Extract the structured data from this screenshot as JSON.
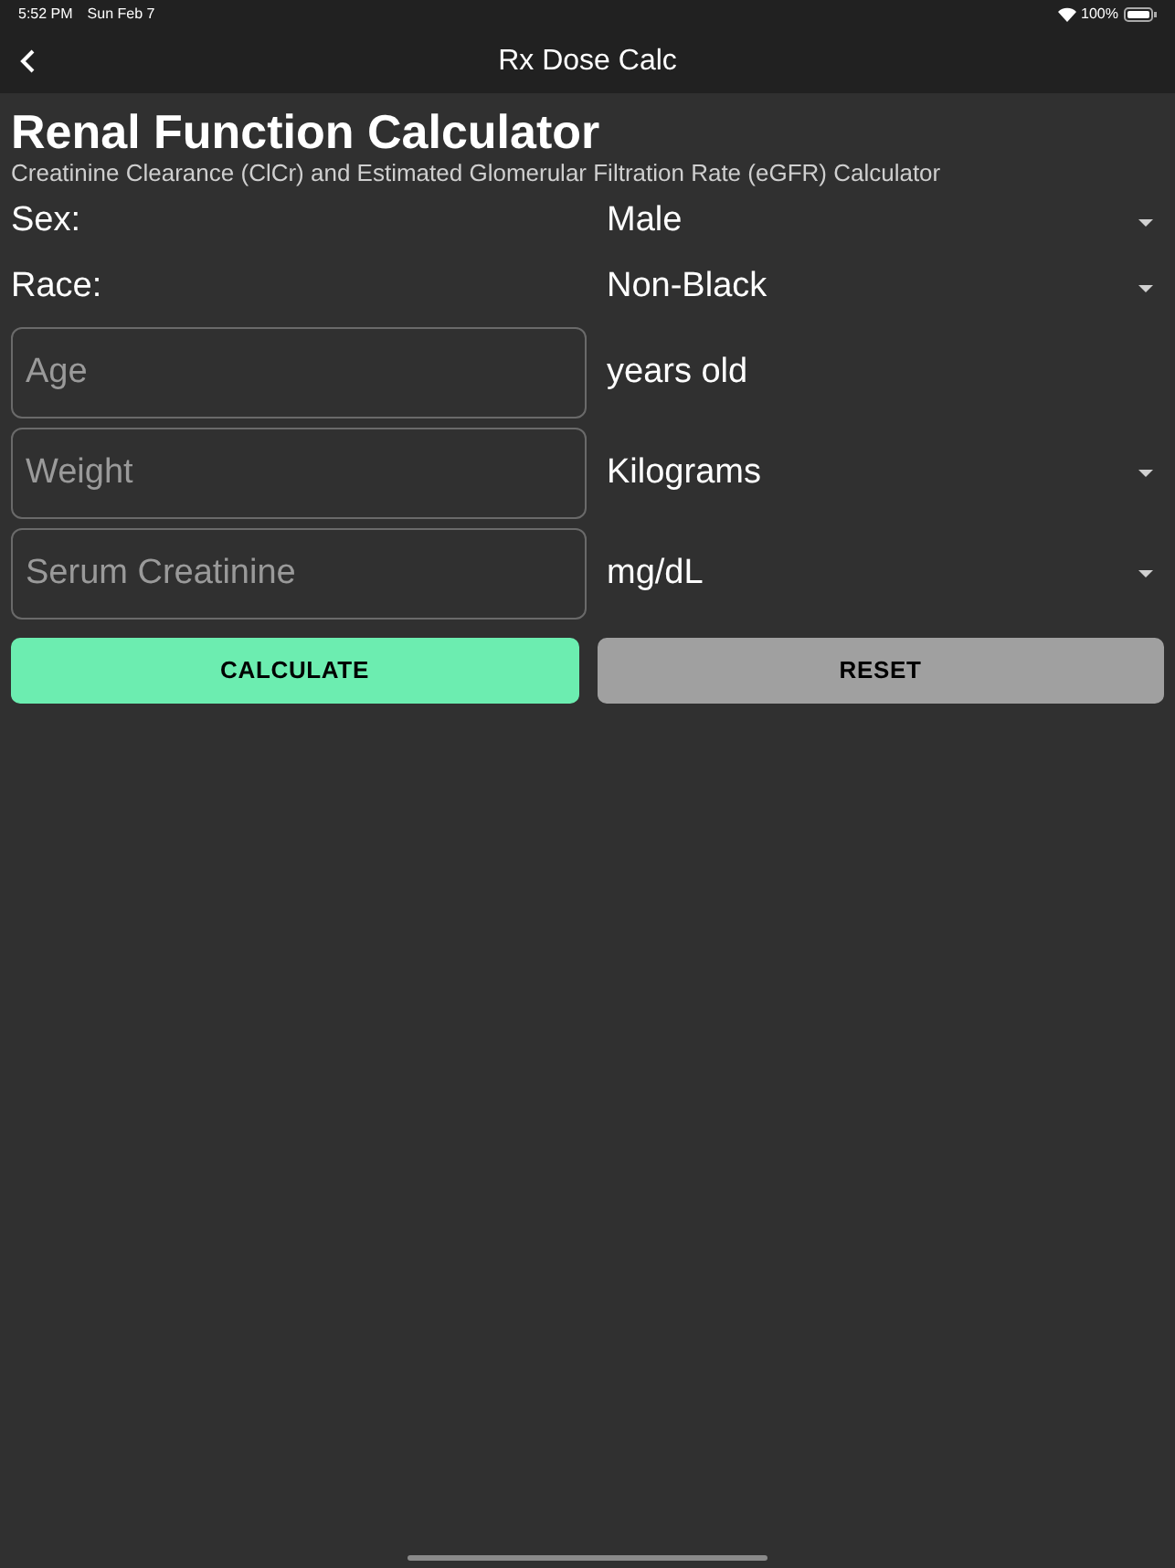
{
  "status_bar": {
    "time": "5:52 PM",
    "date": "Sun Feb 7",
    "battery": "100%"
  },
  "nav_bar": {
    "title": "Rx Dose Calc"
  },
  "title": "Renal Function Calculator",
  "subtitle": "Creatinine Clearance (ClCr) and Estimated Glomerular Filtration Rate (eGFR) Calculator",
  "selects": [
    {
      "label": "Sex:",
      "value": "Male"
    },
    {
      "label": "Race:",
      "value": "Non-Black"
    }
  ],
  "inputs": [
    {
      "placeholder": "Age",
      "unit": "years old",
      "kind": "text"
    },
    {
      "placeholder": "Weight",
      "unit": "Kilograms",
      "kind": "dropdown"
    },
    {
      "placeholder": "Serum Creatinine",
      "unit": "mg/dL",
      "kind": "dropdown"
    }
  ],
  "buttons": [
    {
      "label": "CALCULATE",
      "kind": "primary"
    },
    {
      "label": "RESET",
      "kind": "secondary"
    }
  ]
}
